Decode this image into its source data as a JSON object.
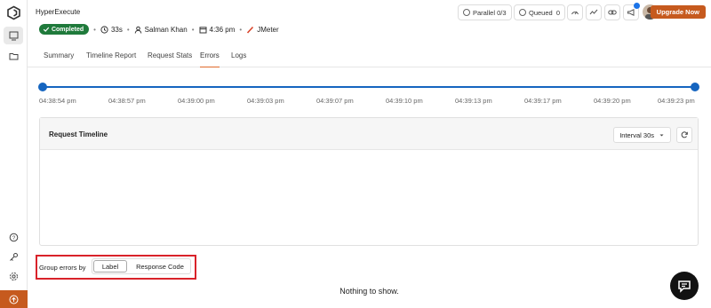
{
  "header": {
    "app_title": "HyperExecute",
    "parallel_label": "Parallel",
    "parallel_value": "0/3",
    "queued_label": "Queued",
    "queued_value": "0",
    "upgrade_label": "Upgrade Now"
  },
  "meta": {
    "status": "Completed",
    "duration": "33s",
    "user": "Salman Khan",
    "time": "4:36 pm",
    "tool": "JMeter"
  },
  "tabs": [
    {
      "label": "Summary"
    },
    {
      "label": "Timeline Report"
    },
    {
      "label": "Request Stats"
    },
    {
      "label": "Errors",
      "active": true
    },
    {
      "label": "Logs"
    }
  ],
  "timeline": {
    "ticks": [
      "04:38:54 pm",
      "04:38:57 pm",
      "04:39:00 pm",
      "04:39:03 pm",
      "04:39:07 pm",
      "04:39:10 pm",
      "04:39:13 pm",
      "04:39:17 pm",
      "04:39:20 pm",
      "04:39:23 pm"
    ]
  },
  "panel": {
    "title": "Request Timeline",
    "interval_value": "Interval 30s"
  },
  "group_errors": {
    "label": "Group errors by",
    "options": [
      "Label",
      "Response Code"
    ],
    "selected": "Label"
  },
  "empty_message": "Nothing to show.",
  "colors": {
    "accent": "#c65a1e",
    "completed": "#1f7a3b",
    "timeline": "#1565c0",
    "highlight": "#d9222a"
  }
}
